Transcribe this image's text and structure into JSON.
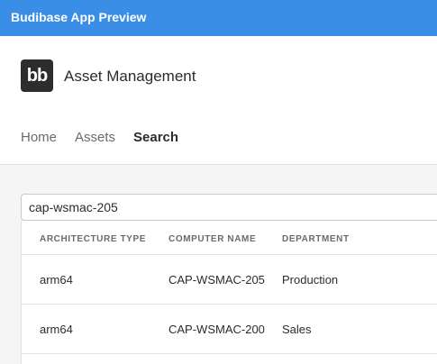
{
  "window": {
    "title": "Budibase App Preview"
  },
  "app": {
    "logo_text": "bb",
    "name": "Asset Management"
  },
  "nav": {
    "items": [
      "Home",
      "Assets",
      "Search"
    ],
    "active": "Search"
  },
  "search": {
    "value": "cap-wsmac-205"
  },
  "table": {
    "columns": [
      "ARCHITECTURE TYPE",
      "COMPUTER NAME",
      "DEPARTMENT"
    ],
    "rows": [
      [
        "arm64",
        "CAP-WSMAC-205",
        "Production"
      ],
      [
        "arm64",
        "CAP-WSMAC-200",
        "Sales"
      ]
    ]
  }
}
